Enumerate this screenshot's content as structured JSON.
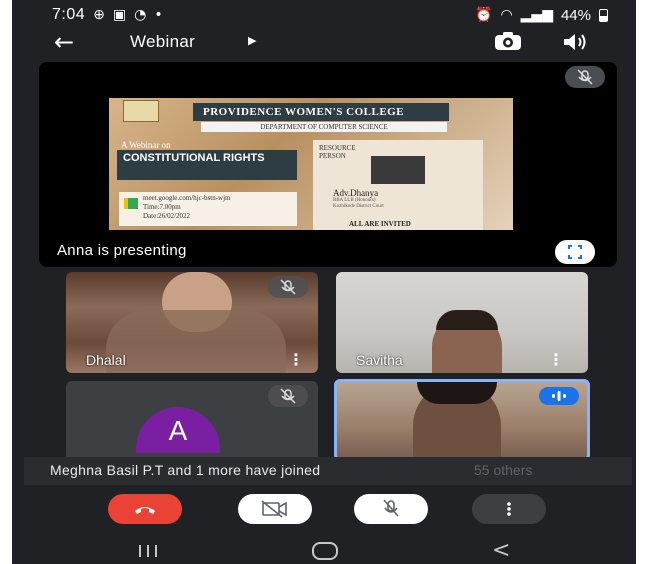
{
  "status_bar": {
    "time": "7:04",
    "battery": "44%"
  },
  "top_bar": {
    "title": "Webinar"
  },
  "presentation": {
    "presenter_label": "Anna is presenting",
    "slide": {
      "college": "PROVIDENCE WOMEN'S COLLEGE",
      "department": "DEPARTMENT OF COMPUTER SCIENCE",
      "webinar_on": "A Webinar on",
      "topic": "CONSTITUTIONAL RIGHTS",
      "meet_link": "meet.google.com/hjc-bstn-wjm",
      "time": "Time:7.00pm",
      "date": "Date:26/02/2022",
      "resource_person": "RESOURCE PERSON",
      "speaker_name": "Adv.Dhanya",
      "speaker_cred_1": "BBA LLB (Honours)",
      "speaker_cred_2": "Kozhikode District Court",
      "invite": "ALL ARE INVITED"
    }
  },
  "participants": [
    {
      "name": "Dhalal"
    },
    {
      "name": "Savitha"
    },
    {
      "initial": "A"
    },
    {
      "name": ""
    }
  ],
  "toast": {
    "message": "Meghna Basil P.T and 1 more have joined",
    "others": "55 others"
  },
  "colors": {
    "end_call": "#ea4335",
    "speaking_border": "#8ab4f8",
    "avatar": "#7b1fa2",
    "background": "#202124"
  }
}
